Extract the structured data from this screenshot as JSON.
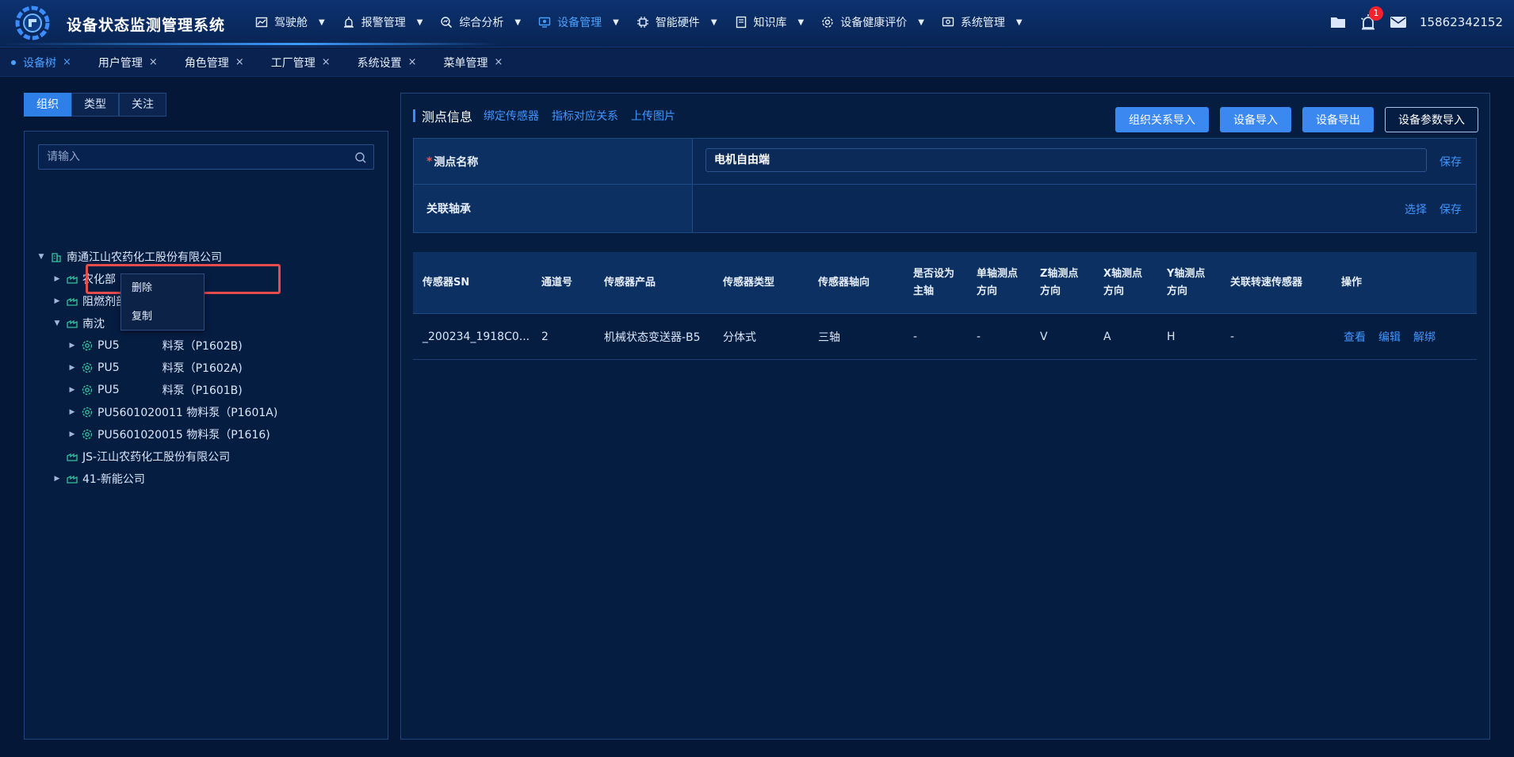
{
  "app": {
    "title": "设备状态监测管理系统"
  },
  "nav": {
    "items": [
      {
        "label": "驾驶舱",
        "icon": "dashboard-icon"
      },
      {
        "label": "报警管理",
        "icon": "alarm-icon"
      },
      {
        "label": "综合分析",
        "icon": "analysis-icon"
      },
      {
        "label": "设备管理",
        "icon": "device-icon",
        "active": true
      },
      {
        "label": "智能硬件",
        "icon": "chip-icon"
      },
      {
        "label": "知识库",
        "icon": "book-icon"
      },
      {
        "label": "设备健康评价",
        "icon": "gear-icon"
      },
      {
        "label": "系统管理",
        "icon": "settings-icon"
      }
    ],
    "caret": "▼",
    "notification_count": "1",
    "user": "15862342152"
  },
  "tabs": [
    {
      "label": "设备树",
      "active": true
    },
    {
      "label": "用户管理"
    },
    {
      "label": "角色管理"
    },
    {
      "label": "工厂管理"
    },
    {
      "label": "系统设置"
    },
    {
      "label": "菜单管理"
    }
  ],
  "tab_close": "×",
  "left": {
    "segments": [
      "组织",
      "类型",
      "关注"
    ],
    "search_placeholder": "请输入",
    "tree": [
      {
        "label": "南通江山农药化工股份有限公司",
        "level": 0,
        "arrow": "▼",
        "icon": "building-icon"
      },
      {
        "label": "农化部",
        "level": 1,
        "arrow": "▶",
        "icon": "factory-icon"
      },
      {
        "label": "阻燃剂部",
        "level": 1,
        "arrow": "▶",
        "icon": "factory-icon"
      },
      {
        "label": "南沈",
        "level": 1,
        "arrow": "▼",
        "icon": "factory-icon"
      },
      {
        "label": "PU5601020013 物料泵（P1602B)",
        "visible": "PU5",
        "tail": "料泵（P1602B)",
        "level": 2,
        "arrow": "▶",
        "icon": "device-gear-icon"
      },
      {
        "label": "PU5601020012 物料泵（P1602A)",
        "visible": "PU5",
        "tail": "料泵（P1602A)",
        "level": 2,
        "arrow": "▶",
        "icon": "device-gear-icon"
      },
      {
        "label": "PU5601020010 物料泵（P1601B)",
        "visible": "PU5",
        "tail": "料泵（P1601B)",
        "level": 2,
        "arrow": "▶",
        "icon": "device-gear-icon"
      },
      {
        "label": "PU5601020011 物料泵（P1601A)",
        "level": 2,
        "arrow": "▶",
        "icon": "device-gear-icon"
      },
      {
        "label": "PU5601020015 物料泵（P1616)",
        "level": 2,
        "arrow": "▶",
        "icon": "device-gear-icon"
      },
      {
        "label": "JS-江山农药化工股份有限公司",
        "level": 1,
        "arrow": "",
        "icon": "factory-icon"
      },
      {
        "label": "41-新能公司",
        "level": 1,
        "arrow": "▶",
        "icon": "factory-icon"
      }
    ],
    "context_menu": [
      "删除",
      "复制"
    ]
  },
  "right": {
    "title": "测点信息",
    "links": [
      "绑定传感器",
      "指标对应关系",
      "上传图片"
    ],
    "actions": [
      "组织关系导入",
      "设备导入",
      "设备导出",
      "设备参数导入"
    ],
    "form": {
      "name_label": "测点名称",
      "required_mark": "*",
      "name_value": "电机自由端",
      "save": "保存",
      "bearing_label": "关联轴承",
      "select": "选择"
    },
    "columns": [
      "传感器SN",
      "通道号",
      "传感器产品",
      "传感器类型",
      "传感器轴向",
      "是否设为\n主轴",
      "单轴测点\n方向",
      "Z轴测点\n方向",
      "X轴测点\n方向",
      "Y轴测点\n方向",
      "关联转速传感器",
      "操作"
    ],
    "rows": [
      {
        "cells": [
          "_200234_1918C0...",
          "2",
          "机械状态变送器-B5",
          "分体式",
          "三轴",
          "-",
          "-",
          "V",
          "A",
          "H",
          "-"
        ],
        "ops": [
          "查看",
          "编辑",
          "解绑"
        ]
      }
    ]
  },
  "colors": {
    "accent": "#3f96ff",
    "background": "#041736",
    "panel": "#061d42",
    "danger": "#e74c4c"
  }
}
